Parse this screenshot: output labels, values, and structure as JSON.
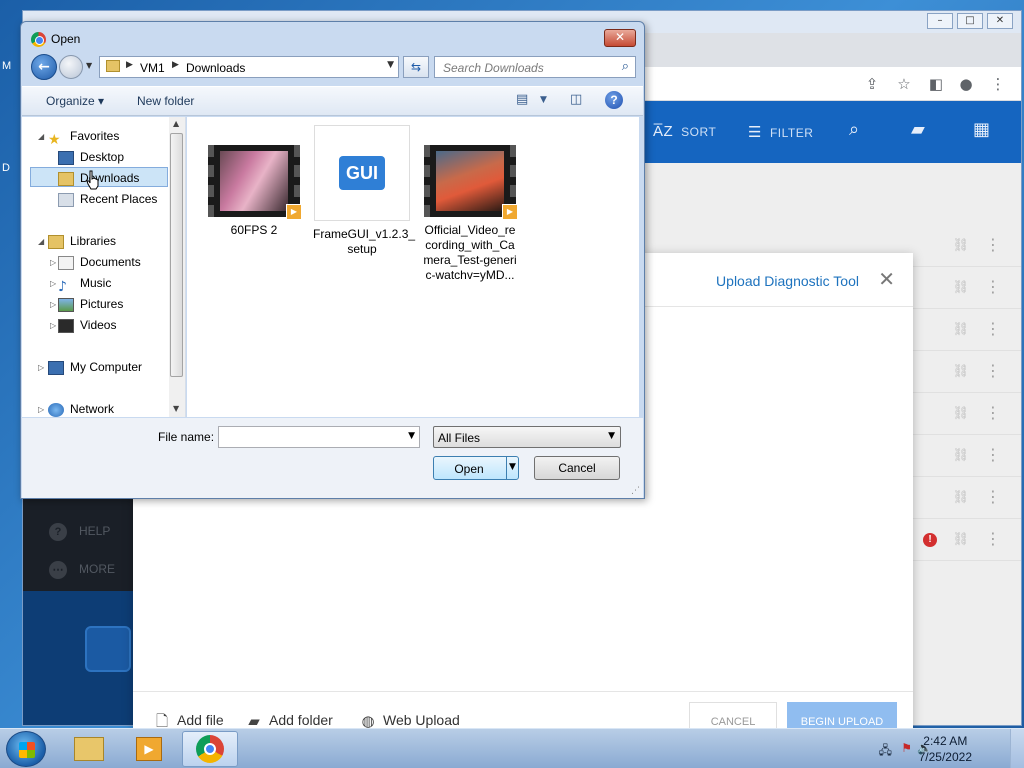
{
  "desktop": {
    "letters": [
      "M",
      "D"
    ]
  },
  "browser": {
    "window_controls": [
      "–",
      "□",
      "✕"
    ]
  },
  "app": {
    "header": {
      "sort_label": "SORT",
      "filter_label": "FILTER",
      "sort_prefix": "A̅Z"
    },
    "sidebar": {
      "help_label": "HELP",
      "more_label": "MORE"
    }
  },
  "upload_modal": {
    "title": "Upload Diagnostic Tool",
    "add_file_label": "Add file",
    "add_folder_label": "Add folder",
    "web_upload_label": "Web Upload",
    "cancel_label": "CANCEL",
    "begin_upload_label": "BEGIN UPLOAD"
  },
  "open_dialog": {
    "title": "Open",
    "address": {
      "segments": [
        "VM1",
        "Downloads"
      ]
    },
    "search_placeholder": "Search Downloads",
    "toolbar": {
      "organize_label": "Organize ▾",
      "new_folder_label": "New folder"
    },
    "nav": {
      "favorites_label": "Favorites",
      "favorites": [
        "Desktop",
        "Downloads",
        "Recent Places"
      ],
      "libraries_label": "Libraries",
      "libraries": [
        "Documents",
        "Music",
        "Pictures",
        "Videos"
      ],
      "computer_label": "My Computer",
      "network_label": "Network",
      "selected": "Downloads"
    },
    "files": [
      {
        "name": "60FPS 2",
        "kind": "video"
      },
      {
        "name": "FrameGUI_v1.2.3_setup",
        "kind": "installer",
        "badge": "GUI",
        "lines": [
          "FrameGUI_v1.2.3_",
          "setup"
        ]
      },
      {
        "name": "Official_Video_recording_with_Camera_Test-generic-watchv=yMD...",
        "kind": "video",
        "lines": [
          "Official_Video_re",
          "cording_with_Ca",
          "mera_Test-generi",
          "c-watchv=yMD..."
        ]
      }
    ],
    "file_name_label": "File name:",
    "file_name_value": "",
    "file_type_value": "All Files",
    "open_label": "Open",
    "cancel_label": "Cancel"
  },
  "taskbar": {
    "time": "2:42 AM",
    "date": "7/25/2022"
  },
  "colors": {
    "app_header": "#1565c0",
    "modal_title": "#1e73be",
    "begin_upload": "#90bdf0",
    "dialog_frame": "#c9daf0"
  }
}
